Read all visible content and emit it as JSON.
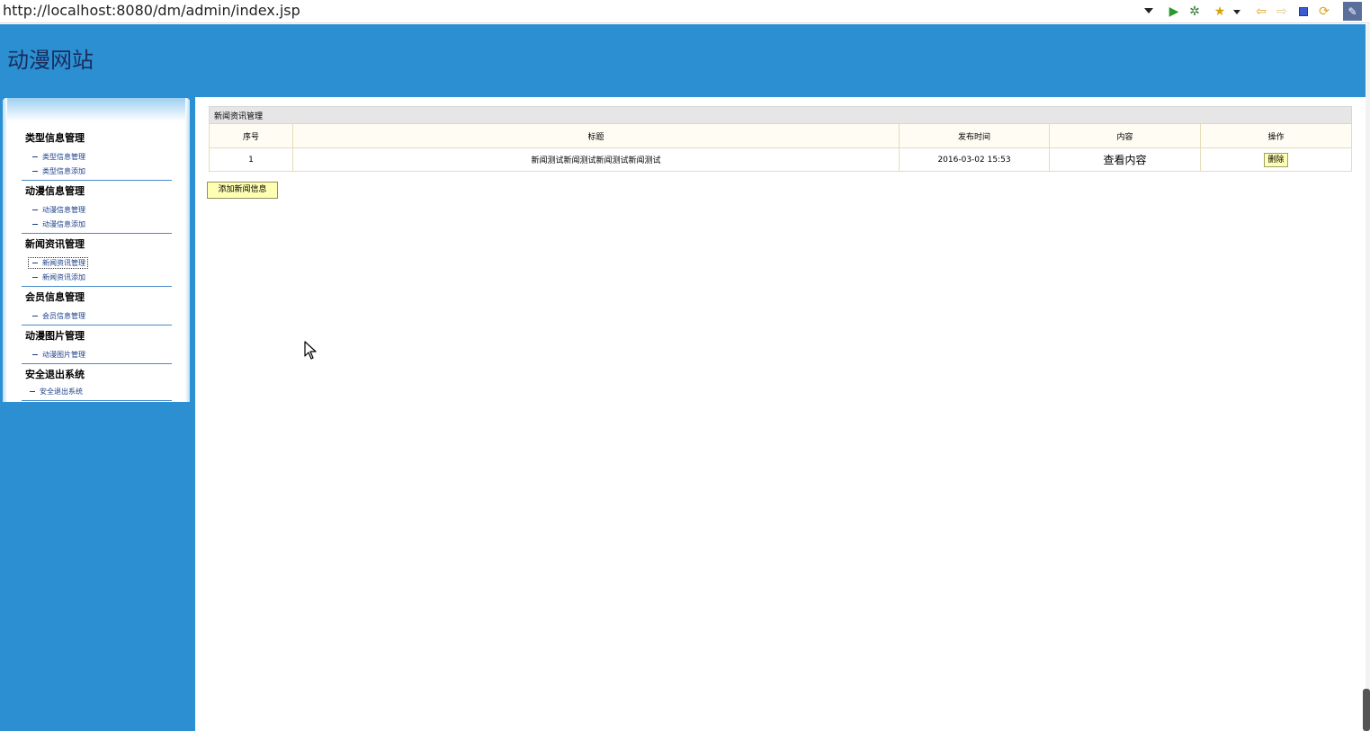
{
  "browser": {
    "url": "http://localhost:8080/dm/admin/index.jsp",
    "toolbar_icons": [
      "run-icon",
      "debug-icon",
      "favorite-icon",
      "back-icon",
      "forward-icon",
      "stop-icon",
      "refresh-icon",
      "eclipse-icon"
    ]
  },
  "header": {
    "site_title": "动漫网站",
    "bg_color": "#2b8fd2"
  },
  "sidebar": {
    "groups": [
      {
        "title": "类型信息管理",
        "links": [
          "类型信息管理",
          "类型信息添加"
        ]
      },
      {
        "title": "动漫信息管理",
        "links": [
          "动漫信息管理",
          "动漫信息添加"
        ]
      },
      {
        "title": "新闻资讯管理",
        "links": [
          "新闻资讯管理",
          "新闻资讯添加"
        ]
      },
      {
        "title": "会员信息管理",
        "links": [
          "会员信息管理"
        ]
      },
      {
        "title": "动漫图片管理",
        "links": [
          "动漫图片管理"
        ]
      },
      {
        "title": "安全退出系统",
        "links": [
          "安全退出系统"
        ]
      }
    ],
    "active_link": "新闻资讯管理"
  },
  "main": {
    "table_caption": "新闻资讯管理",
    "columns": [
      "序号",
      "标题",
      "发布时间",
      "内容",
      "操作"
    ],
    "rows": [
      {
        "index": "1",
        "title": "新闻测试新闻测试新闻测试新闻测试",
        "time": "2016-03-02 15:53",
        "content": "查看内容",
        "action": "删除"
      }
    ],
    "add_button": "添加新闻信息"
  }
}
